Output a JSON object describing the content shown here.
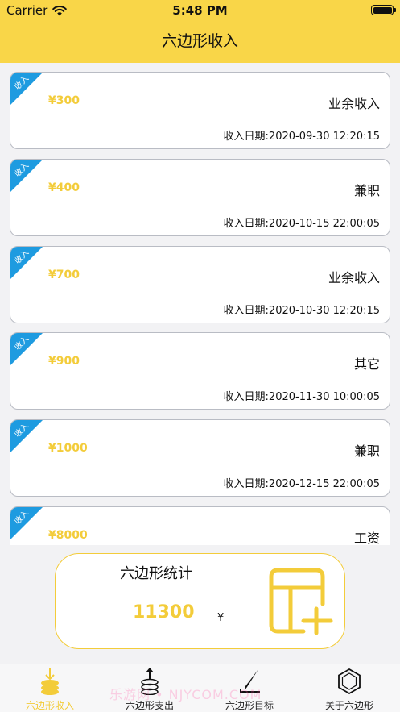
{
  "status_bar": {
    "carrier": "Carrier",
    "time": "5:48 PM"
  },
  "nav": {
    "title": "六边形收入"
  },
  "colors": {
    "accent": "#f9d648",
    "amount": "#f3cc3a",
    "ribbon": "#1e9be0"
  },
  "records": [
    {
      "badge": "收入",
      "amount": "¥300",
      "category": "业余收入",
      "date": "收入日期:2020-09-30 12:20:15"
    },
    {
      "badge": "收入",
      "amount": "¥400",
      "category": "兼职",
      "date": "收入日期:2020-10-15 22:00:05"
    },
    {
      "badge": "收入",
      "amount": "¥700",
      "category": "业余收入",
      "date": "收入日期:2020-10-30 12:20:15"
    },
    {
      "badge": "收入",
      "amount": "¥900",
      "category": "其它",
      "date": "收入日期:2020-11-30 10:00:05"
    },
    {
      "badge": "收入",
      "amount": "¥1000",
      "category": "兼职",
      "date": "收入日期:2020-12-15 22:00:05"
    },
    {
      "badge": "收入",
      "amount": "¥8000",
      "category": "工资",
      "date": ""
    }
  ],
  "summary": {
    "title": "六边形统计",
    "total": "11300",
    "unit": "¥",
    "add_icon": "add-record-icon"
  },
  "tabs": [
    {
      "label": "六边形收入",
      "icon": "income-coins-icon",
      "active": true
    },
    {
      "label": "六边形支出",
      "icon": "expense-coins-icon",
      "active": false
    },
    {
      "label": "六边形目标",
      "icon": "pen-target-icon",
      "active": false
    },
    {
      "label": "关于六边形",
      "icon": "hexagon-icon",
      "active": false
    }
  ],
  "watermark": "乐游网 • NJYCOM.COM"
}
